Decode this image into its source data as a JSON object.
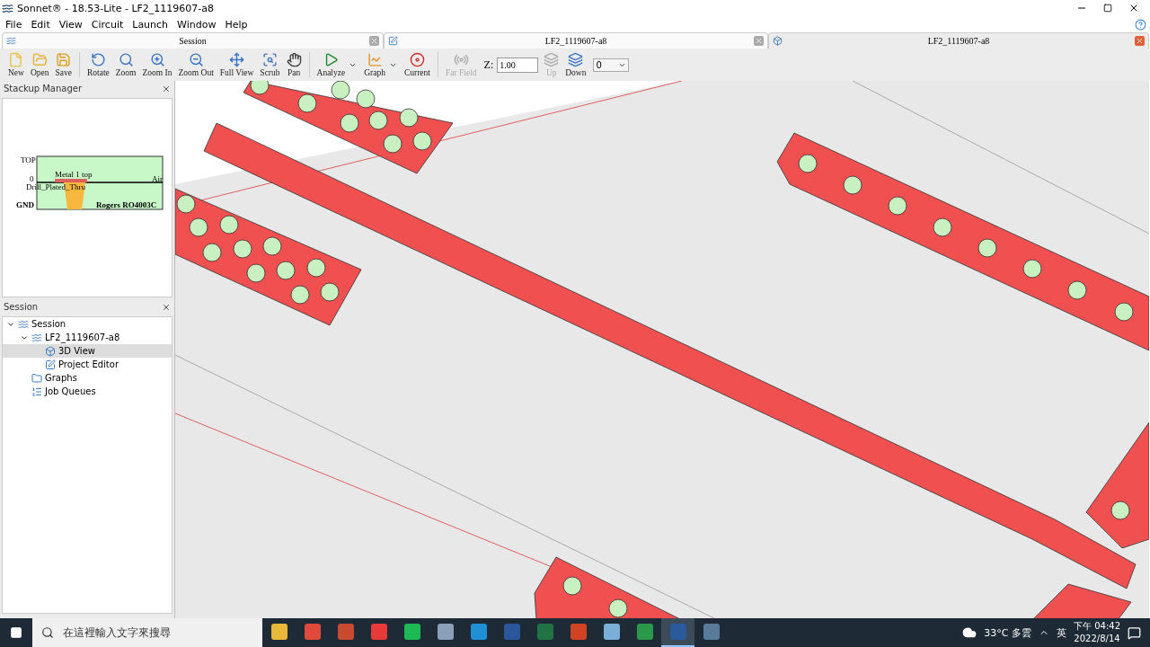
{
  "window": {
    "title": "Sonnet® - 18.53-Lite - LF2_1119607-a8"
  },
  "menu": [
    "File",
    "Edit",
    "View",
    "Circuit",
    "Launch",
    "Window",
    "Help"
  ],
  "tabs": [
    {
      "label": "Session",
      "selected": false
    },
    {
      "label": "LF2_1119607-a8",
      "selected": false
    },
    {
      "label": "LF2_1119607-a8",
      "selected": true
    }
  ],
  "toolbar": [
    {
      "label": "New",
      "disabled": false,
      "has_menu": false
    },
    {
      "label": "Open",
      "disabled": false,
      "has_menu": false
    },
    {
      "label": "Save",
      "disabled": false,
      "has_menu": false
    },
    {
      "label": "Rotate",
      "disabled": false,
      "has_menu": false
    },
    {
      "label": "Zoom",
      "disabled": false,
      "has_menu": false
    },
    {
      "label": "Zoom In",
      "disabled": false,
      "has_menu": false
    },
    {
      "label": "Zoom Out",
      "disabled": false,
      "has_menu": false
    },
    {
      "label": "Full View",
      "disabled": false,
      "has_menu": false
    },
    {
      "label": "Scrub",
      "disabled": false,
      "has_menu": false
    },
    {
      "label": "Pan",
      "disabled": false,
      "has_menu": false
    },
    {
      "label": "Analyze",
      "disabled": false,
      "has_menu": true
    },
    {
      "label": "Graph",
      "disabled": false,
      "has_menu": true
    },
    {
      "label": "Current",
      "disabled": false,
      "has_menu": false
    },
    {
      "label": "Far Field",
      "disabled": true,
      "has_menu": false
    }
  ],
  "z_field": {
    "label": "Z:",
    "value": "1.00"
  },
  "layer_buttons": [
    {
      "label": "Up",
      "disabled": true
    },
    {
      "label": "Down",
      "disabled": false
    }
  ],
  "layer_select": {
    "value": "0"
  },
  "stackup_manager": {
    "title": "Stackup Manager",
    "levels": [
      "TOP",
      "0",
      "GND"
    ],
    "layers": [
      "Metal 1 top",
      "Air",
      "Drill_Plated_Thru",
      "Rogers RO4003C"
    ]
  },
  "session_panel": {
    "title": "Session",
    "tree": [
      {
        "label": "Session",
        "expanded": true,
        "selected": false,
        "children": [
          {
            "label": "LF2_1119607-a8",
            "expanded": true,
            "selected": false,
            "children": [
              {
                "label": "3D View",
                "selected": true
              },
              {
                "label": "Project Editor",
                "selected": false
              }
            ]
          },
          {
            "label": "Graphs",
            "selected": false
          },
          {
            "label": "Job Queues",
            "selected": false
          }
        ]
      }
    ]
  },
  "taskbar": {
    "search": {
      "placeholder": "在這裡輸入文字來搜尋"
    },
    "apps": [
      {
        "active": false
      },
      {
        "active": false
      },
      {
        "active": false
      },
      {
        "active": false
      },
      {
        "active": false
      },
      {
        "active": false
      },
      {
        "active": false
      },
      {
        "active": false
      },
      {
        "active": false
      },
      {
        "active": false
      },
      {
        "active": false
      },
      {
        "active": false
      },
      {
        "active": true
      },
      {
        "active": false
      }
    ],
    "weather": "33°C 多雲",
    "ime": "英",
    "time": "下午 04:42",
    "date": "2022/8/14"
  }
}
